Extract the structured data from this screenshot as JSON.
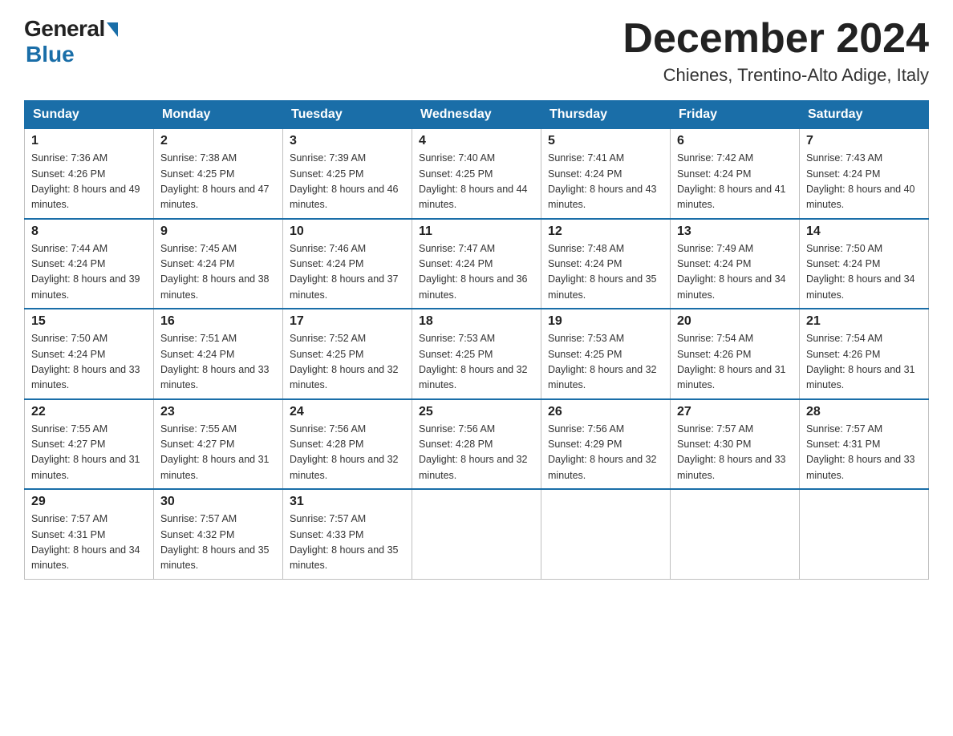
{
  "logo": {
    "general": "General",
    "blue": "Blue"
  },
  "title": "December 2024",
  "subtitle": "Chienes, Trentino-Alto Adige, Italy",
  "days_of_week": [
    "Sunday",
    "Monday",
    "Tuesday",
    "Wednesday",
    "Thursday",
    "Friday",
    "Saturday"
  ],
  "weeks": [
    [
      {
        "day": "1",
        "sunrise": "7:36 AM",
        "sunset": "4:26 PM",
        "daylight": "8 hours and 49 minutes."
      },
      {
        "day": "2",
        "sunrise": "7:38 AM",
        "sunset": "4:25 PM",
        "daylight": "8 hours and 47 minutes."
      },
      {
        "day": "3",
        "sunrise": "7:39 AM",
        "sunset": "4:25 PM",
        "daylight": "8 hours and 46 minutes."
      },
      {
        "day": "4",
        "sunrise": "7:40 AM",
        "sunset": "4:25 PM",
        "daylight": "8 hours and 44 minutes."
      },
      {
        "day": "5",
        "sunrise": "7:41 AM",
        "sunset": "4:24 PM",
        "daylight": "8 hours and 43 minutes."
      },
      {
        "day": "6",
        "sunrise": "7:42 AM",
        "sunset": "4:24 PM",
        "daylight": "8 hours and 41 minutes."
      },
      {
        "day": "7",
        "sunrise": "7:43 AM",
        "sunset": "4:24 PM",
        "daylight": "8 hours and 40 minutes."
      }
    ],
    [
      {
        "day": "8",
        "sunrise": "7:44 AM",
        "sunset": "4:24 PM",
        "daylight": "8 hours and 39 minutes."
      },
      {
        "day": "9",
        "sunrise": "7:45 AM",
        "sunset": "4:24 PM",
        "daylight": "8 hours and 38 minutes."
      },
      {
        "day": "10",
        "sunrise": "7:46 AM",
        "sunset": "4:24 PM",
        "daylight": "8 hours and 37 minutes."
      },
      {
        "day": "11",
        "sunrise": "7:47 AM",
        "sunset": "4:24 PM",
        "daylight": "8 hours and 36 minutes."
      },
      {
        "day": "12",
        "sunrise": "7:48 AM",
        "sunset": "4:24 PM",
        "daylight": "8 hours and 35 minutes."
      },
      {
        "day": "13",
        "sunrise": "7:49 AM",
        "sunset": "4:24 PM",
        "daylight": "8 hours and 34 minutes."
      },
      {
        "day": "14",
        "sunrise": "7:50 AM",
        "sunset": "4:24 PM",
        "daylight": "8 hours and 34 minutes."
      }
    ],
    [
      {
        "day": "15",
        "sunrise": "7:50 AM",
        "sunset": "4:24 PM",
        "daylight": "8 hours and 33 minutes."
      },
      {
        "day": "16",
        "sunrise": "7:51 AM",
        "sunset": "4:24 PM",
        "daylight": "8 hours and 33 minutes."
      },
      {
        "day": "17",
        "sunrise": "7:52 AM",
        "sunset": "4:25 PM",
        "daylight": "8 hours and 32 minutes."
      },
      {
        "day": "18",
        "sunrise": "7:53 AM",
        "sunset": "4:25 PM",
        "daylight": "8 hours and 32 minutes."
      },
      {
        "day": "19",
        "sunrise": "7:53 AM",
        "sunset": "4:25 PM",
        "daylight": "8 hours and 32 minutes."
      },
      {
        "day": "20",
        "sunrise": "7:54 AM",
        "sunset": "4:26 PM",
        "daylight": "8 hours and 31 minutes."
      },
      {
        "day": "21",
        "sunrise": "7:54 AM",
        "sunset": "4:26 PM",
        "daylight": "8 hours and 31 minutes."
      }
    ],
    [
      {
        "day": "22",
        "sunrise": "7:55 AM",
        "sunset": "4:27 PM",
        "daylight": "8 hours and 31 minutes."
      },
      {
        "day": "23",
        "sunrise": "7:55 AM",
        "sunset": "4:27 PM",
        "daylight": "8 hours and 31 minutes."
      },
      {
        "day": "24",
        "sunrise": "7:56 AM",
        "sunset": "4:28 PM",
        "daylight": "8 hours and 32 minutes."
      },
      {
        "day": "25",
        "sunrise": "7:56 AM",
        "sunset": "4:28 PM",
        "daylight": "8 hours and 32 minutes."
      },
      {
        "day": "26",
        "sunrise": "7:56 AM",
        "sunset": "4:29 PM",
        "daylight": "8 hours and 32 minutes."
      },
      {
        "day": "27",
        "sunrise": "7:57 AM",
        "sunset": "4:30 PM",
        "daylight": "8 hours and 33 minutes."
      },
      {
        "day": "28",
        "sunrise": "7:57 AM",
        "sunset": "4:31 PM",
        "daylight": "8 hours and 33 minutes."
      }
    ],
    [
      {
        "day": "29",
        "sunrise": "7:57 AM",
        "sunset": "4:31 PM",
        "daylight": "8 hours and 34 minutes."
      },
      {
        "day": "30",
        "sunrise": "7:57 AM",
        "sunset": "4:32 PM",
        "daylight": "8 hours and 35 minutes."
      },
      {
        "day": "31",
        "sunrise": "7:57 AM",
        "sunset": "4:33 PM",
        "daylight": "8 hours and 35 minutes."
      },
      null,
      null,
      null,
      null
    ]
  ]
}
